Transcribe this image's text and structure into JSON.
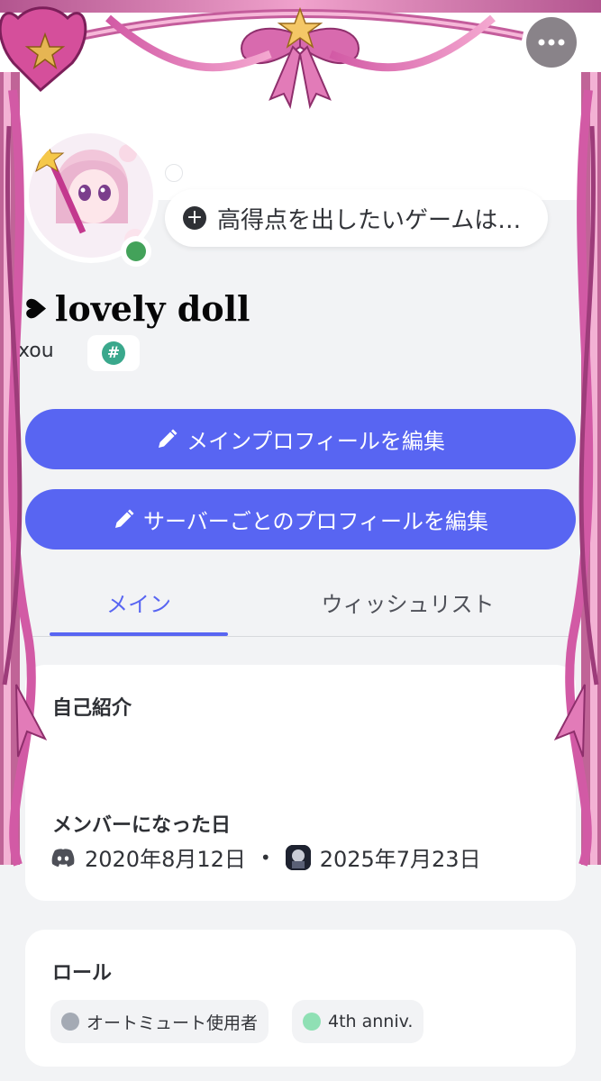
{
  "status": {
    "custom_status_text": "高得点を出したいゲームは…",
    "online_color": "#43a25a"
  },
  "profile": {
    "display_name": "lovely doll",
    "username": "uxou",
    "tag_symbol": "#"
  },
  "buttons": {
    "edit_main": "メインプロフィールを編集",
    "edit_server": "サーバーごとのプロフィールを編集"
  },
  "tabs": [
    {
      "label": "メイン",
      "active": true
    },
    {
      "label": "ウィッシュリスト",
      "active": false
    }
  ],
  "about": {
    "heading": "自己紹介",
    "member_since_heading": "メンバーになった日",
    "discord_join_date": "2020年8月12日",
    "separator": "•",
    "server_join_date": "2025年7月23日"
  },
  "roles": {
    "heading": "ロール",
    "items": [
      {
        "name": "オートミュート使用者",
        "color": "#a4aab4"
      },
      {
        "name": "4th anniv.",
        "color": "#8fe0b4"
      }
    ]
  },
  "icons": {
    "more": "more-icon",
    "add_status": "plus-circle-icon",
    "edit": "pencil-icon",
    "discord": "discord-icon"
  },
  "theme": {
    "accent": "#5865f2",
    "frame_pink": "#e58bc0",
    "frame_dark": "#a94b86",
    "background": "#f2f3f5"
  }
}
